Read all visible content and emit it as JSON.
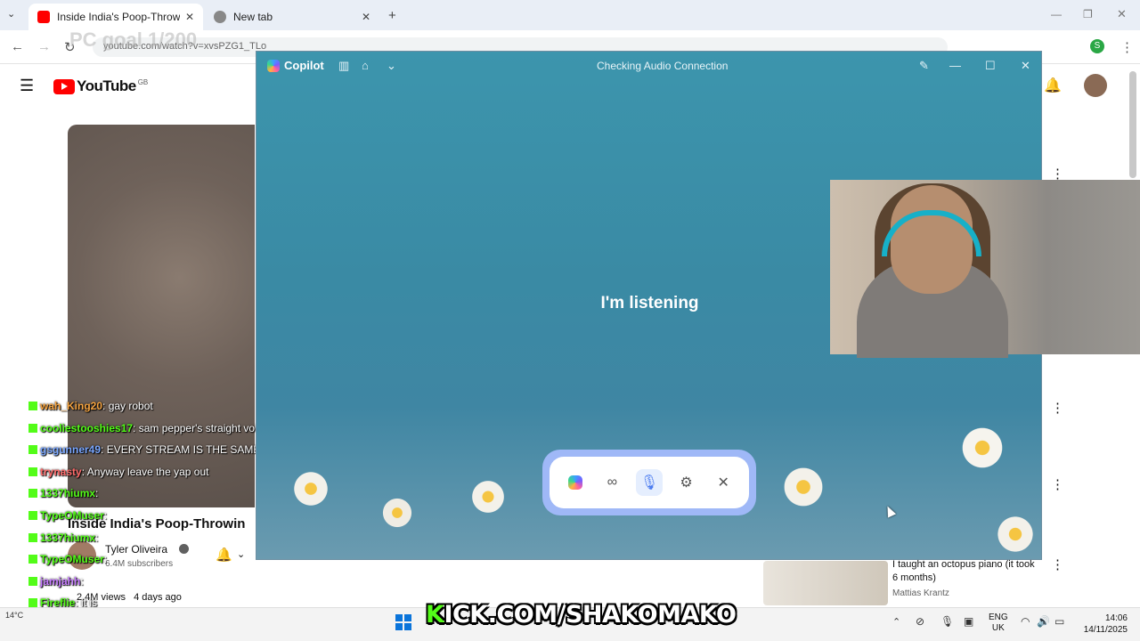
{
  "browser": {
    "tabs": [
      {
        "label": "Inside India's Poop-Throwing Fe",
        "active": true
      },
      {
        "label": "New tab",
        "active": false
      }
    ],
    "new_tab_symbol": "+",
    "url": "youtube.com/watch?v=xvsPZG1_TLo",
    "profile_initial": "S"
  },
  "overlay": {
    "goal_text": "PC goal 1/200",
    "banner_prefix": "K",
    "banner_text": "ICK.COM/SHAKOMAKO"
  },
  "youtube": {
    "logo_text": "YouTube",
    "region": "GB",
    "video_title": "Inside India's Poop-Throwin",
    "channel": "Tyler Oliveira",
    "subscribers": "6.4M subscribers",
    "views": "2.4M views",
    "uploaded": "4 days ago",
    "side_video_title": "I taught an octopus piano (it took 6 months)",
    "side_video_channel": "Mattias Krantz"
  },
  "chat": [
    {
      "user": "wah_King20",
      "message": "gay robot",
      "color": "#f4a340"
    },
    {
      "user": "cooliestooshies17",
      "message": "sam pepper's straight voice?",
      "color": "#53fc18"
    },
    {
      "user": "gsgunner49",
      "message": "EVERY STREAM IS THE SAME IT STREAM",
      "color": "#7aa7ff"
    },
    {
      "user": "trynasty",
      "message": "Anyway leave the yap out",
      "color": "#ff6b6b"
    },
    {
      "user": "1337hiumx",
      "message": "",
      "color": "#53fc18"
    },
    {
      "user": "TypeOMuser",
      "message": "",
      "color": "#53fc18"
    },
    {
      "user": "1337hiumx",
      "message": "",
      "color": "#53fc18"
    },
    {
      "user": "TypeOMuser",
      "message": "",
      "color": "#53fc18"
    },
    {
      "user": "jamjahh",
      "message": "",
      "color": "#c77dff"
    },
    {
      "user": "Fireflie",
      "message": "it is",
      "color": "#53fc18"
    },
    {
      "user": "1337hiumx",
      "message": "",
      "color": "#53fc18"
    }
  ],
  "copilot": {
    "app_name": "Copilot",
    "window_title": "Checking Audio Connection",
    "status": "I'm listening",
    "controls": [
      {
        "name": "copilot-logo",
        "icon": "◆"
      },
      {
        "name": "vision",
        "icon": "∞"
      },
      {
        "name": "microphone",
        "icon": "🎙"
      },
      {
        "name": "settings",
        "icon": "⚙"
      },
      {
        "name": "close",
        "icon": "✕"
      }
    ]
  },
  "taskbar": {
    "language_line1": "ENG",
    "language_line2": "UK",
    "time": "14:06",
    "date": "14/11/2025",
    "weather": "14°C"
  }
}
